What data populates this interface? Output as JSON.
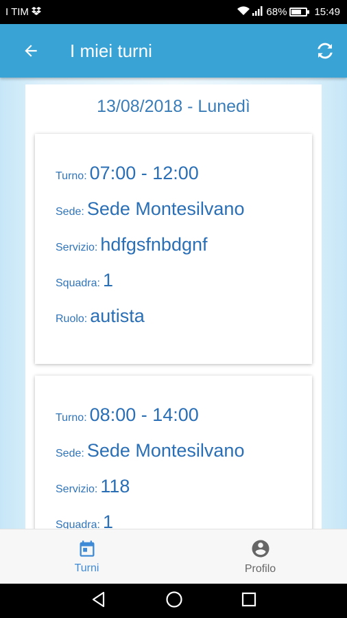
{
  "status_bar": {
    "carrier": "I TIM",
    "battery_percent": "68%",
    "time": "15:49",
    "icons": [
      "dropbox-icon",
      "wifi-icon",
      "signal-icon",
      "battery-icon"
    ]
  },
  "app_bar": {
    "title": "I miei turni",
    "back_icon": "arrow-left-icon",
    "refresh_icon": "refresh-icon",
    "color": "#3aa3d6"
  },
  "day": {
    "heading": "13/08/2018 - Lunedì"
  },
  "shifts": [
    {
      "turno_label": "Turno:",
      "turno": "07:00 - 12:00",
      "sede_label": "Sede:",
      "sede": "Sede Montesilvano",
      "servizio_label": "Servizio:",
      "servizio": "hdfgsfnbdgnf",
      "squadra_label": "Squadra:",
      "squadra": "1",
      "ruolo_label": "Ruolo:",
      "ruolo": "autista"
    },
    {
      "turno_label": "Turno:",
      "turno": "08:00 - 14:00",
      "sede_label": "Sede:",
      "sede": "Sede Montesilvano",
      "servizio_label": "Servizio:",
      "servizio": "118",
      "squadra_label": "Squadra:",
      "squadra": "1"
    }
  ],
  "bottom_nav": {
    "items": [
      {
        "label": "Turni",
        "icon": "calendar-icon",
        "active": true
      },
      {
        "label": "Profilo",
        "icon": "account-circle-icon",
        "active": false
      }
    ],
    "active_color": "#3f8ad6"
  },
  "system_nav": {
    "icons": [
      "back-triangle-icon",
      "home-circle-icon",
      "recents-square-icon"
    ]
  }
}
